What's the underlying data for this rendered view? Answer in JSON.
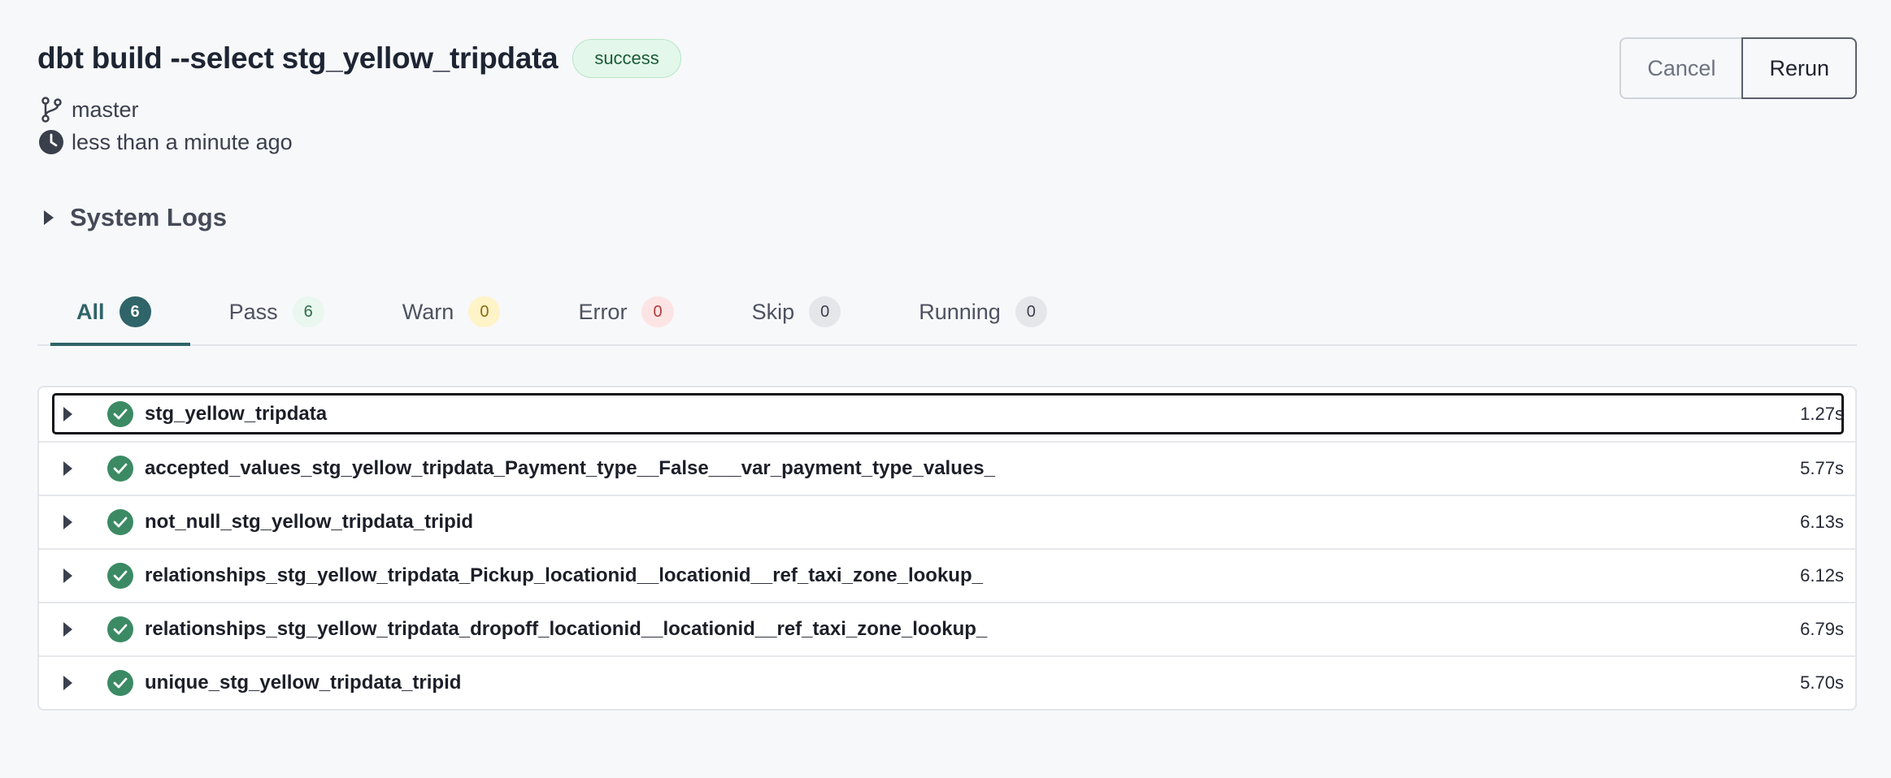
{
  "header": {
    "title": "dbt build --select stg_yellow_tripdata",
    "status": "success",
    "branch": "master",
    "time": "less than a minute ago",
    "cancel_label": "Cancel",
    "rerun_label": "Rerun"
  },
  "system_logs": {
    "label": "System Logs"
  },
  "tabs": [
    {
      "label": "All",
      "count": "6"
    },
    {
      "label": "Pass",
      "count": "6"
    },
    {
      "label": "Warn",
      "count": "0"
    },
    {
      "label": "Error",
      "count": "0"
    },
    {
      "label": "Skip",
      "count": "0"
    },
    {
      "label": "Running",
      "count": "0"
    }
  ],
  "results": [
    {
      "name": "stg_yellow_tripdata",
      "duration": "1.27s",
      "status": "pass"
    },
    {
      "name": "accepted_values_stg_yellow_tripdata_Payment_type__False___var_payment_type_values_",
      "duration": "5.77s",
      "status": "pass"
    },
    {
      "name": "not_null_stg_yellow_tripdata_tripid",
      "duration": "6.13s",
      "status": "pass"
    },
    {
      "name": "relationships_stg_yellow_tripdata_Pickup_locationid__locationid__ref_taxi_zone_lookup_",
      "duration": "6.12s",
      "status": "pass"
    },
    {
      "name": "relationships_stg_yellow_tripdata_dropoff_locationid__locationid__ref_taxi_zone_lookup_",
      "duration": "6.79s",
      "status": "pass"
    },
    {
      "name": "unique_stg_yellow_tripdata_tripid",
      "duration": "5.70s",
      "status": "pass"
    }
  ],
  "colors": {
    "accent": "#2f6468",
    "success": "#3b8a63"
  },
  "icons": {
    "branch": "git-branch-icon",
    "time": "clock-icon",
    "expand": "caret-right-icon",
    "status": "check-circle-icon"
  }
}
